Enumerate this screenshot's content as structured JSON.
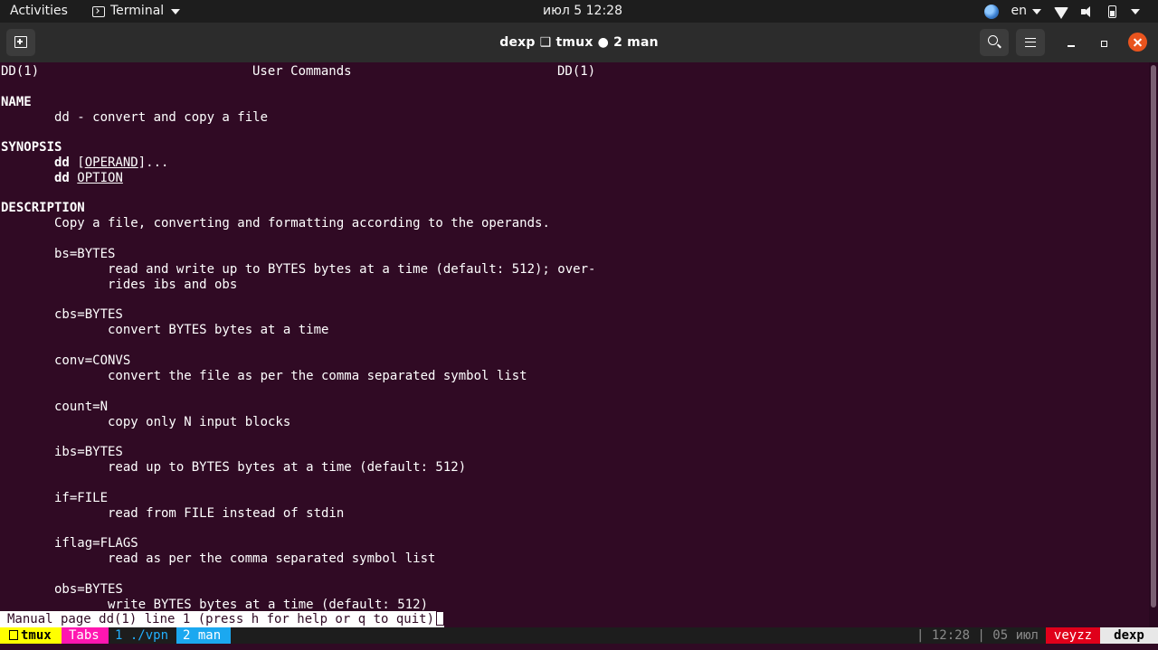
{
  "topbar": {
    "activities": "Activities",
    "app_name": "Terminal",
    "clock": "июл 5  12:28",
    "language": "en"
  },
  "window": {
    "title": "dexp ❑ tmux ● 2 man"
  },
  "man": {
    "header_left": "DD(1)",
    "header_center": "User Commands",
    "header_right": "DD(1)",
    "name_heading": "NAME",
    "name_text": "dd - convert and copy a file",
    "synopsis_heading": "SYNOPSIS",
    "synopsis_cmd": "dd",
    "synopsis_arg1": "OPERAND",
    "synopsis_arg1_pre": " [",
    "synopsis_arg1_post": "]...",
    "synopsis_arg2": "OPTION",
    "description_heading": "DESCRIPTION",
    "description_text": "Copy a file, converting and formatting according to the operands.",
    "options": [
      {
        "name": "bs=BYTES",
        "desc": [
          "read and write up to BYTES bytes at a time (default: 512); over-",
          "rides ibs and obs"
        ]
      },
      {
        "name": "cbs=BYTES",
        "desc": [
          "convert BYTES bytes at a time"
        ]
      },
      {
        "name": "conv=CONVS",
        "desc": [
          "convert the file as per the comma separated symbol list"
        ]
      },
      {
        "name": "count=N",
        "desc": [
          "copy only N input blocks"
        ]
      },
      {
        "name": "ibs=BYTES",
        "desc": [
          "read up to BYTES bytes at a time (default: 512)"
        ]
      },
      {
        "name": "if=FILE",
        "desc": [
          "read from FILE instead of stdin"
        ]
      },
      {
        "name": "iflag=FLAGS",
        "desc": [
          "read as per the comma separated symbol list"
        ]
      },
      {
        "name": "obs=BYTES",
        "desc": [
          "write BYTES bytes at a time (default: 512)"
        ]
      }
    ],
    "status_line": "Manual page dd(1) line 1 (press h for help or q to quit)"
  },
  "tmux": {
    "session": "tmux",
    "tabs": "Tabs",
    "window1": "1 ./vpn",
    "window2": "2 man",
    "right_info": "| 12:28 | 05 июл",
    "user": "veyzz",
    "host": "dexp"
  },
  "colors": {
    "terminal_bg": "#300a24",
    "close_button": "#e9541e",
    "tmux_session": "#ffff00",
    "tmux_tabs": "#ff16b0",
    "tmux_active_window": "#1ba8f0",
    "tmux_user": "#e0001a"
  }
}
